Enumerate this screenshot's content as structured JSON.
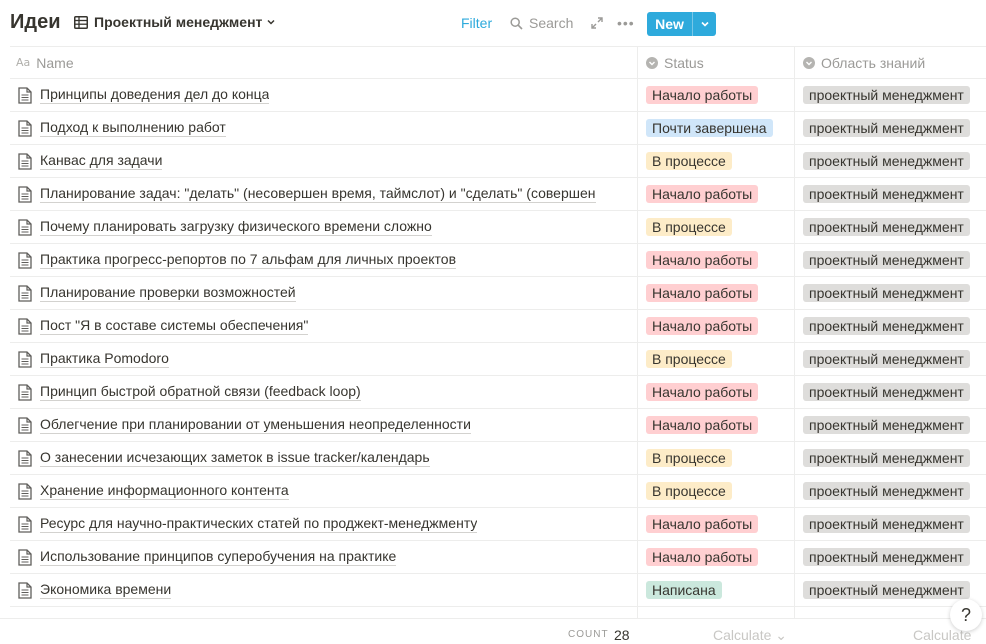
{
  "title": "Идеи",
  "view": {
    "label": "Проектный менеджмент",
    "icon": "table-icon"
  },
  "toolbar": {
    "filter": "Filter",
    "search": "Search",
    "more": "•••",
    "new": "New"
  },
  "columns": [
    {
      "label": "Name",
      "icon": "text-property-icon",
      "icon_text": "Aa"
    },
    {
      "label": "Status",
      "icon": "select-property-icon"
    },
    {
      "label": "Область знаний",
      "icon": "select-property-icon"
    }
  ],
  "colors": {
    "accent": "#2eaadc",
    "red": "#ffcfd1",
    "blue": "#d0e6f9",
    "yellow": "#fdecc8",
    "green": "#cbe8dd",
    "gray": "#dedddb"
  },
  "rows": [
    {
      "name": "Принципы доведения дел до конца",
      "status": "Начало работы",
      "status_color": "red",
      "area": "проектный менеджмент"
    },
    {
      "name": "Подход к выполнению работ",
      "status": "Почти завершена",
      "status_color": "blue",
      "area": "проектный менеджмент"
    },
    {
      "name": "Канвас для задачи",
      "status": "В процессе",
      "status_color": "yellow",
      "area": "проектный менеджмент"
    },
    {
      "name": "Планирование задач: \"делать\" (несовершен время, таймслот) и \"сделать\" (совершен",
      "status": "Начало работы",
      "status_color": "red",
      "area": "проектный менеджмент"
    },
    {
      "name": "Почему планировать загрузку физического времени сложно",
      "status": "В процессе",
      "status_color": "yellow",
      "area": "проектный менеджмент"
    },
    {
      "name": "Практика прогресс-репортов по 7 альфам для личных проектов",
      "status": "Начало работы",
      "status_color": "red",
      "area": "проектный менеджмент"
    },
    {
      "name": "Планирование проверки возможностей",
      "status": "Начало работы",
      "status_color": "red",
      "area": "проектный менеджмент"
    },
    {
      "name": "Пост \"Я в составе системы обеспечения\"",
      "status": "Начало работы",
      "status_color": "red",
      "area": "проектный менеджмент"
    },
    {
      "name": "Практика Pomodoro",
      "status": "В процессе",
      "status_color": "yellow",
      "area": "проектный менеджмент"
    },
    {
      "name": "Принцип быстрой обратной связи (feedback loop)",
      "status": "Начало работы",
      "status_color": "red",
      "area": "проектный менеджмент"
    },
    {
      "name": "Облегчение при планировании от уменьшения неопределенности",
      "status": "Начало работы",
      "status_color": "red",
      "area": "проектный менеджмент"
    },
    {
      "name": "О занесении исчезающих заметок в issue tracker/календарь",
      "status": "В процессе",
      "status_color": "yellow",
      "area": "проектный менеджмент"
    },
    {
      "name": "Хранение информационного контента",
      "status": "В процессе",
      "status_color": "yellow",
      "area": "проектный менеджмент"
    },
    {
      "name": "Ресурс для научно-практических статей по проджект-менеджменту",
      "status": "Начало работы",
      "status_color": "red",
      "area": "проектный менеджмент"
    },
    {
      "name": "Использование принципов суперобучения на практике",
      "status": "Начало работы",
      "status_color": "red",
      "area": "проектный менеджмент"
    },
    {
      "name": "Экономика времени",
      "status": "Написана",
      "status_color": "green",
      "area": "проектный менеджмент"
    }
  ],
  "footer": {
    "count_label": "COUNT",
    "count": "28",
    "calculate": "Calculate",
    "help": "?"
  }
}
